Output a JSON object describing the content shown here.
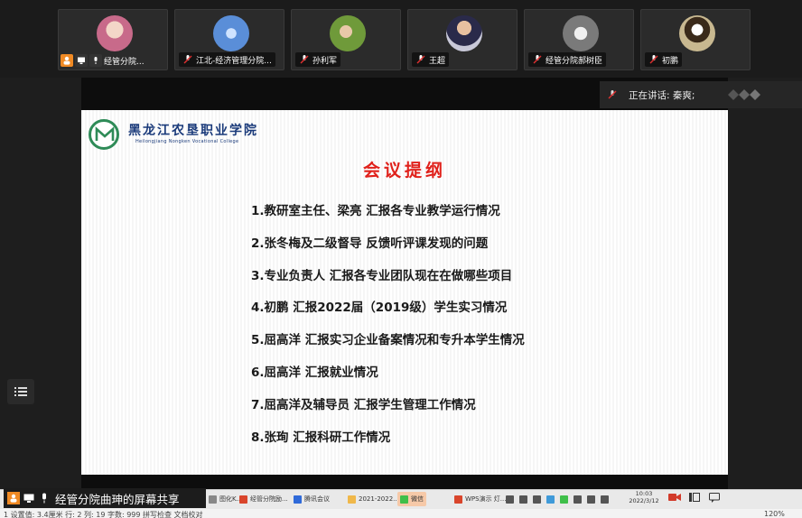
{
  "participants": [
    {
      "name": "经管分院...",
      "avatar_color": "#c86a8a",
      "host": true
    },
    {
      "name": "江北-经济管理分院...",
      "avatar_color": "#5a8ed8",
      "host": false
    },
    {
      "name": "孙利军",
      "avatar_color": "#6f9a3a",
      "host": false
    },
    {
      "name": "王超",
      "avatar_color": "#8a6a4a",
      "host": false
    },
    {
      "name": "经管分院郝树臣",
      "avatar_color": "#9a9a9a",
      "host": false
    },
    {
      "name": "初鹏",
      "avatar_color": "#c8b890",
      "host": false
    }
  ],
  "speaking": {
    "label": "正在讲话: 秦爽;"
  },
  "slide": {
    "school_cn": "黑龙江农垦职业学院",
    "school_en": "Heilongjiang Nongken Vocational College",
    "title": "会议提纲",
    "items": [
      "1.教研室主任、梁亮 汇报各专业教学运行情况",
      "2.张冬梅及二级督导 反馈听评课发现的问题",
      "3.专业负责人 汇报各专业团队现在在做哪些项目",
      "4.初鹏 汇报2022届（2019级）学生实习情况",
      "5.屈高洋 汇报实习企业备案情况和专升本学生情况",
      "6.屈高洋 汇报就业情况",
      "7.屈高洋及辅导员 汇报学生管理工作情况",
      "8.张珣 汇报科研工作情况"
    ]
  },
  "share": {
    "label": "经管分院曲珅的屏幕共享"
  },
  "taskbar": {
    "tasks": [
      {
        "label": "图化K...",
        "color": "#888888"
      },
      {
        "label": "经管分院励...",
        "color": "#d9452b"
      },
      {
        "label": "腾讯会议",
        "color": "#2f6ad9"
      },
      {
        "label": "2021-2022...",
        "color": "#f0b84a"
      },
      {
        "label": "微信",
        "color": "#3fbf4a"
      },
      {
        "label": "WPS演示 灯...",
        "color": "#d9452b"
      }
    ],
    "clock_time": "10:03",
    "clock_date": "2022/3/12"
  },
  "status": {
    "left": "1 设置值: 3.4厘米   行: 2   列: 19   字数: 999   拼写检查   文档校对",
    "zoom": "120%"
  },
  "colors": {
    "accent_title": "#e0211b",
    "school_blue": "#1a3a7a",
    "logo_green": "#2e8b57"
  }
}
